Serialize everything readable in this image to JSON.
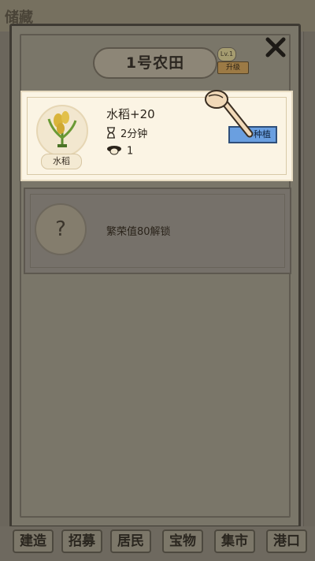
{
  "background_scene": {
    "top_left_text": "储藏",
    "top_right_text": ""
  },
  "dialog": {
    "title": "1号农田",
    "level_badge": "Lv.1",
    "upgrade_label": "升级",
    "close_icon": "close-x-icon"
  },
  "crop_slot": {
    "crop_name": "水稻",
    "reward": "水稻+20",
    "duration": "2分钟",
    "workers": "1",
    "plant_button": "种植",
    "icons": {
      "crop": "rice-plant-icon",
      "time": "hourglass-icon",
      "worker": "worker-icon",
      "pointer": "pointing-hand-icon"
    }
  },
  "locked_slot": {
    "icon": "question-mark-icon",
    "question": "?",
    "unlock_requirement": "繁荣值80解锁"
  },
  "bottom_menu": [
    {
      "label": "建造"
    },
    {
      "label": "招募"
    },
    {
      "label": "居民"
    },
    {
      "label": "宝物"
    },
    {
      "label": "集市"
    },
    {
      "label": "港口"
    }
  ],
  "colors": {
    "plant_button": "#6a9fe0",
    "highlight_card": "#fbf4e4",
    "overlay": "#7a7669"
  }
}
